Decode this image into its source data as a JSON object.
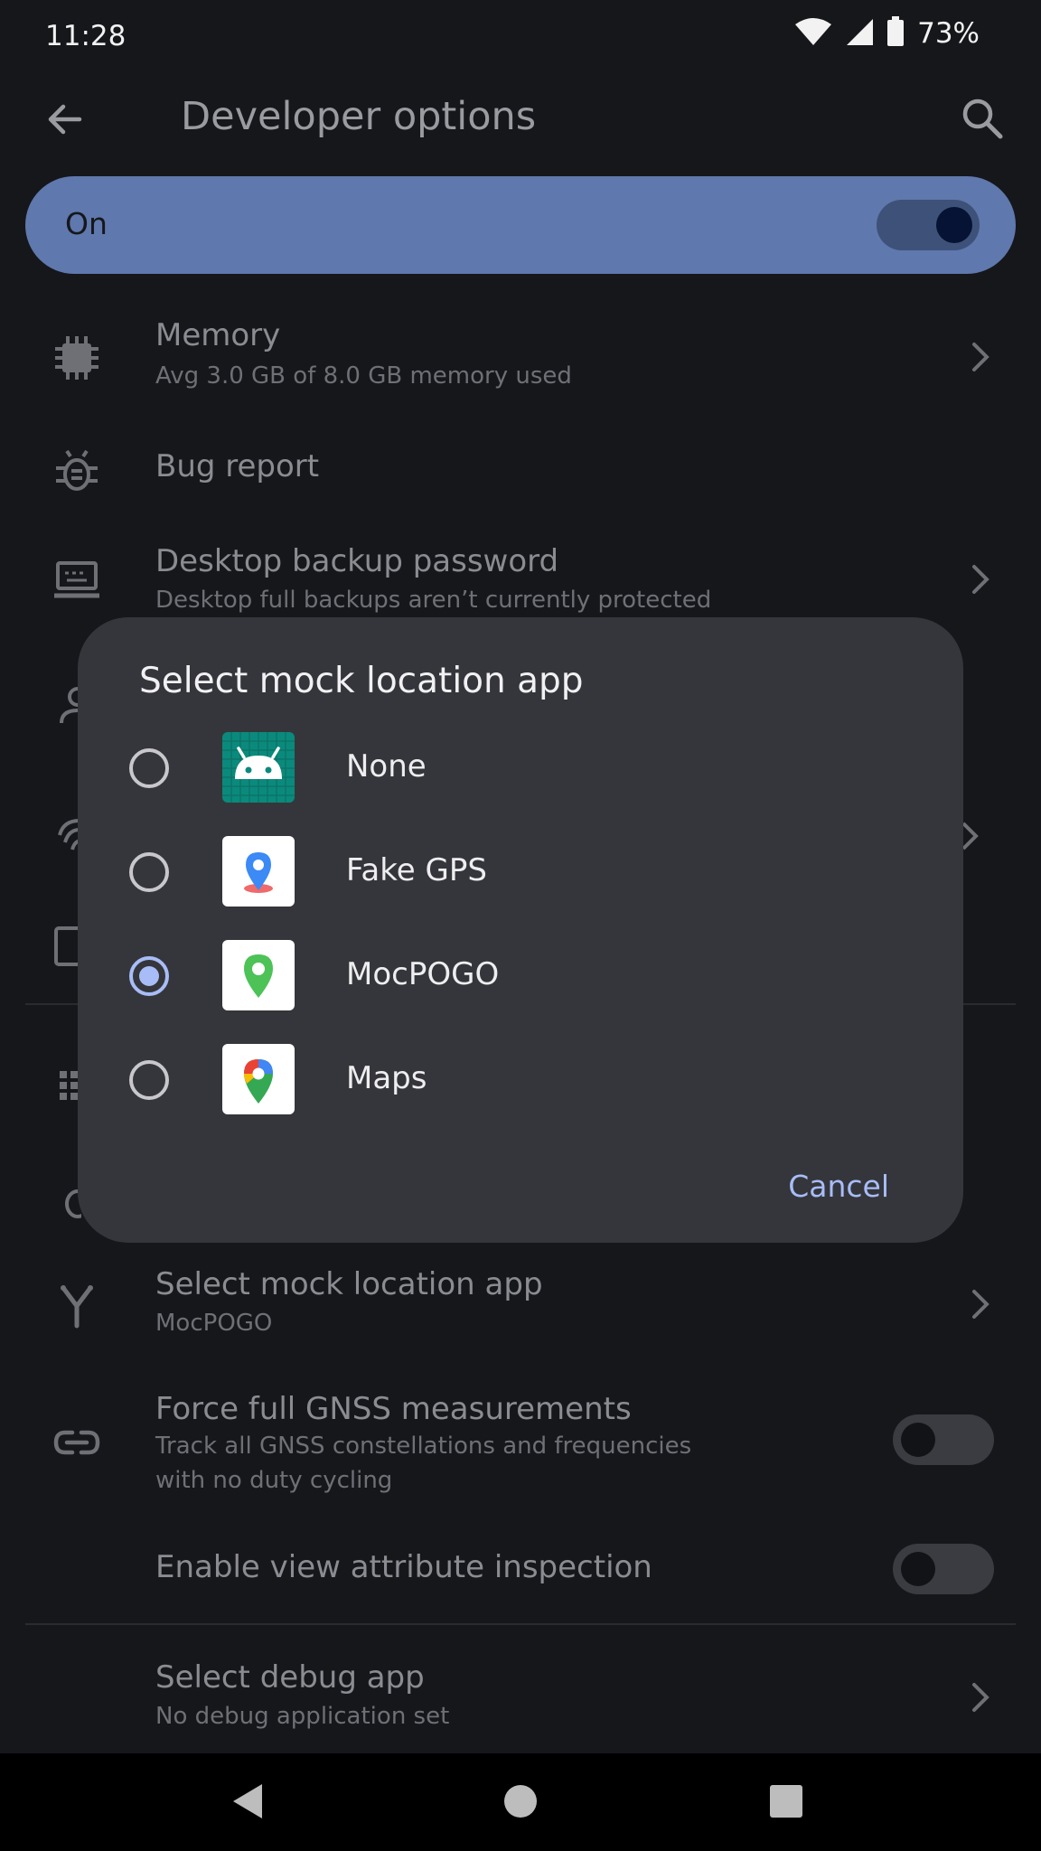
{
  "status_bar": {
    "time": "11:28",
    "battery": "73%"
  },
  "app_bar": {
    "title": "Developer options"
  },
  "main_switch": {
    "label": "On",
    "state": "on"
  },
  "settings": {
    "memory": {
      "title": "Memory",
      "summary": "Avg 3.0 GB of 8.0 GB memory used"
    },
    "bug_report": {
      "title": "Bug report"
    },
    "desktop_backup": {
      "title": "Desktop backup password",
      "summary": "Desktop full backups aren’t currently protected"
    },
    "mock_location": {
      "title": "Select mock location app",
      "summary": "MocPOGO"
    },
    "gnss": {
      "title": "Force full GNSS measurements",
      "summary_line1": "Track all GNSS constellations and frequencies",
      "summary_line2": "with no duty cycling",
      "state": "off"
    },
    "view_attr": {
      "title": "Enable view attribute inspection",
      "state": "off"
    },
    "debug_app": {
      "title": "Select debug app",
      "summary": "No debug application set"
    }
  },
  "dialog": {
    "title": "Select mock location app",
    "options": [
      {
        "label": "None",
        "icon": "android-icon",
        "selected": false
      },
      {
        "label": "Fake GPS",
        "icon": "fake-gps-icon",
        "selected": false
      },
      {
        "label": "MocPOGO",
        "icon": "mocpogo-icon",
        "selected": true
      },
      {
        "label": "Maps",
        "icon": "google-maps-icon",
        "selected": false
      }
    ],
    "cancel_label": "Cancel"
  },
  "colors": {
    "accent": "#a8bdf7",
    "switch_bar": "#5f78ad",
    "background": "#16171b",
    "dialog": "#35363b"
  }
}
